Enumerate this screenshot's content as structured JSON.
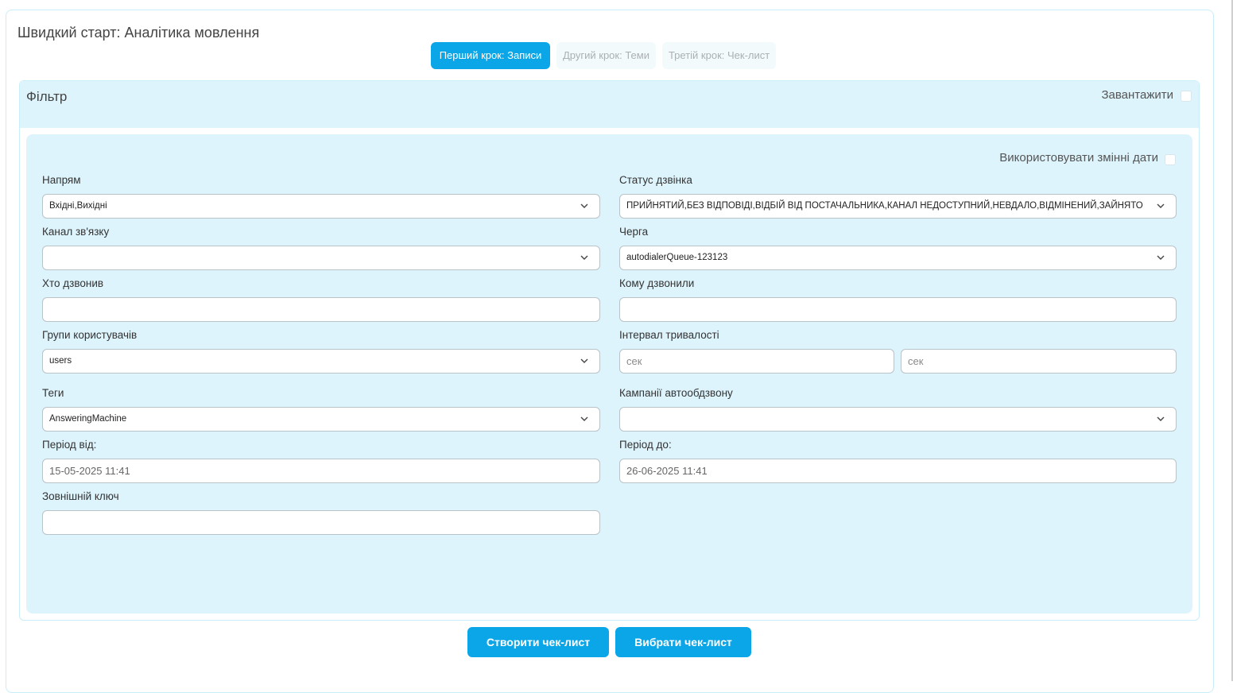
{
  "page": {
    "title": "Швидкий старт: Аналітика мовлення"
  },
  "steps": [
    {
      "label": "Перший крок: Записи",
      "active": true
    },
    {
      "label": "Другий крок: Теми",
      "active": false
    },
    {
      "label": "Третій крок: Чек-лист",
      "active": false
    }
  ],
  "filter": {
    "title": "Фільтр",
    "load_label": "Завантажити",
    "load_checked": false,
    "use_dates_label": "Використовувати змінні дати",
    "use_dates_checked": false,
    "direction": {
      "label": "Напрям",
      "value": "Вхідні,Вихідні"
    },
    "call_status": {
      "label": "Статус дзвінка",
      "value": "ПРИЙНЯТИЙ,БЕЗ ВІДПОВІДІ,ВІДБІЙ ВІД ПОСТАЧАЛЬНИКА,КАНАЛ НЕДОСТУПНИЙ,НЕВДАЛО,ВІДМІНЕНИЙ,ЗАЙНЯТО"
    },
    "channel": {
      "label": "Канал зв'язку",
      "value": ""
    },
    "queue": {
      "label": "Черга",
      "value": "autodialerQueue-123123"
    },
    "caller": {
      "label": "Хто дзвонив",
      "value": ""
    },
    "callee": {
      "label": "Кому дзвонили",
      "value": ""
    },
    "user_groups": {
      "label": "Групи користувачів",
      "value": "users"
    },
    "duration": {
      "label": "Інтервал тривалості",
      "from_placeholder": "сек",
      "to_placeholder": "сек"
    },
    "tags": {
      "label": "Теги",
      "value": "AnsweringMachine"
    },
    "campaigns": {
      "label": "Кампанії автообдзвону",
      "value": ""
    },
    "period_from": {
      "label": "Період від:",
      "value": "15-05-2025 11:41"
    },
    "period_to": {
      "label": "Період до:",
      "value": "26-06-2025 11:41"
    },
    "external_key": {
      "label": "Зовнішній ключ",
      "value": ""
    }
  },
  "buttons": {
    "create_checklist": "Створити чек-лист",
    "choose_checklist": "Вибрати чек-лист"
  },
  "colors": {
    "accent": "#0ba6e8",
    "panel": "#def4fc",
    "border": "#c8eef8"
  }
}
